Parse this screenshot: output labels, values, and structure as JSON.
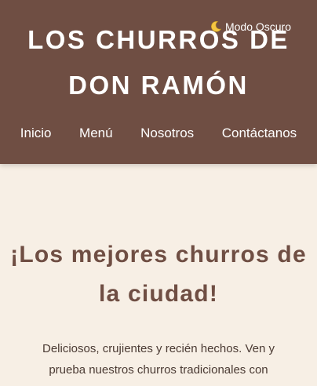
{
  "header": {
    "title": "LOS CHURROS DE DON RAMÓN",
    "dark_mode_toggle": {
      "icon": "moon-icon",
      "label": "Modo Oscuro"
    },
    "nav": [
      {
        "label": "Inicio"
      },
      {
        "label": "Menú"
      },
      {
        "label": "Nosotros"
      },
      {
        "label": "Contáctanos"
      }
    ]
  },
  "hero": {
    "title": "¡Los mejores churros de la ciudad!",
    "text": "Deliciosos, crujientes y recién hechos. Ven y prueba nuestros churros tradicionales con"
  },
  "colors": {
    "header_bg": "#6f4e43",
    "page_bg": "#f7efe5",
    "accent_text": "#6f4e43"
  }
}
